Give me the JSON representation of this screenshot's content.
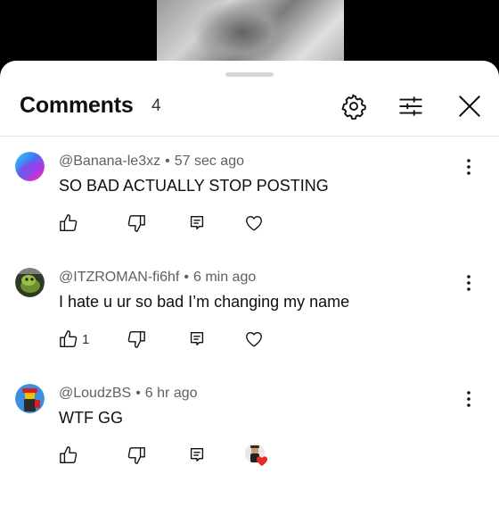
{
  "header": {
    "title": "Comments",
    "count": "4",
    "icons": [
      "gear-icon",
      "filter-sliders-icon",
      "close-icon"
    ]
  },
  "comments": [
    {
      "author": "@Banana-le3xz",
      "time": "57 sec ago",
      "text": "SO BAD ACTUALLY STOP POSTING",
      "likes": "",
      "hearted_by_creator": false
    },
    {
      "author": "@ITZROMAN-fi6hf",
      "time": "6 min ago",
      "text": "I hate u ur so bad I’m changing my name",
      "likes": "1",
      "hearted_by_creator": false
    },
    {
      "author": "@LoudzBS",
      "time": "6 hr ago",
      "text": "WTF GG",
      "likes": "",
      "hearted_by_creator": true
    }
  ],
  "colors": {
    "text_primary": "#0f0f0f",
    "text_secondary": "#606060",
    "divider": "#e3e3e3",
    "creator_heart": "#e52d27"
  }
}
